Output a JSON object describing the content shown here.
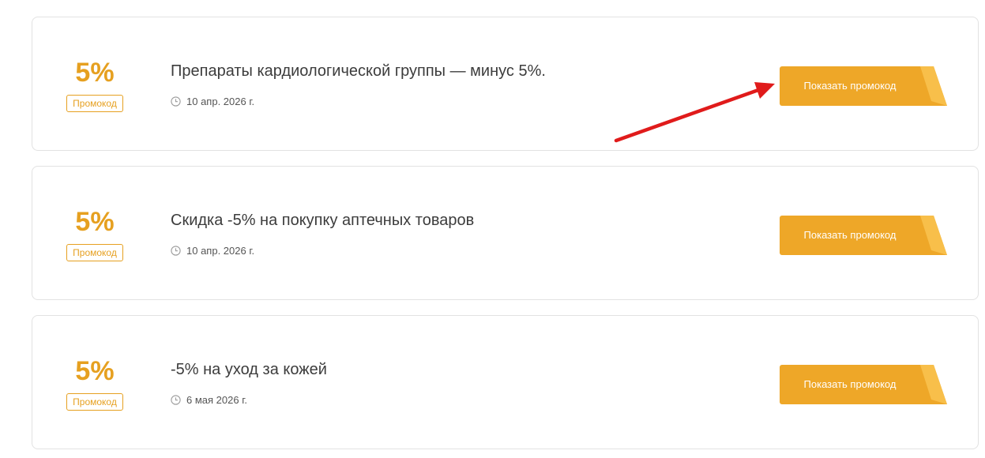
{
  "offers": [
    {
      "discount": "5%",
      "badge": "Промокод",
      "title": "Препараты кардиологической группы — минус 5%.",
      "date": "10 апр. 2026 г.",
      "button_label": "Показать промокод"
    },
    {
      "discount": "5%",
      "badge": "Промокод",
      "title": "Скидка -5% на покупку аптечных товаров",
      "date": "10 апр. 2026 г.",
      "button_label": "Показать промокод"
    },
    {
      "discount": "5%",
      "badge": "Промокод",
      "title": "-5% на уход за кожей",
      "date": "6 мая 2026 г.",
      "button_label": "Показать промокод"
    }
  ],
  "icons": {
    "date": "clock-icon",
    "annotation": "red-arrow-icon"
  },
  "colors": {
    "accent": "#e6a020",
    "button": "#eea728",
    "button_flap": "#f8bf4a",
    "arrow": "#e01b1b",
    "title_text": "#3c3c3c"
  }
}
